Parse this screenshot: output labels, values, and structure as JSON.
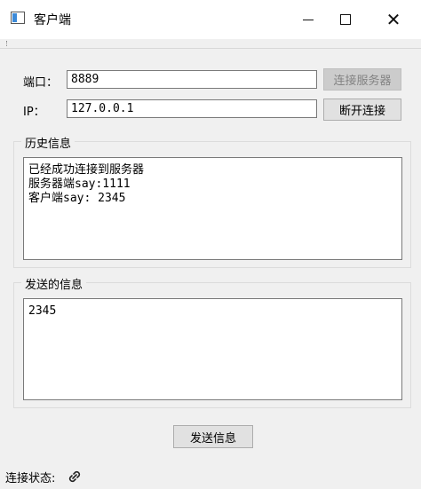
{
  "window": {
    "title": "客户端"
  },
  "form": {
    "port_label": "端口：",
    "port_value": "8889",
    "ip_label": "IP：",
    "ip_value": "127.0.0.1",
    "connect_button": "连接服务器",
    "disconnect_button": "断开连接"
  },
  "history": {
    "title": "历史信息",
    "lines": [
      "已经成功连接到服务器",
      "服务器端say:1111",
      "客户端say: 2345"
    ]
  },
  "send": {
    "title": "发送的信息",
    "text": "2345",
    "button": "发送信息"
  },
  "statusbar": {
    "label": "连接状态:"
  },
  "icons": {
    "app": "app-window-icon",
    "status": "link-icon"
  }
}
